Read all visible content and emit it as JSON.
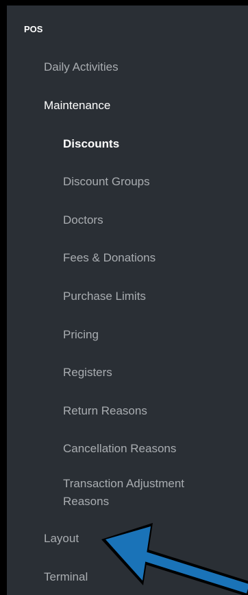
{
  "nav": {
    "root": "POS",
    "daily_activities": "Daily Activities",
    "maintenance": "Maintenance",
    "maintenance_items": [
      "Discounts",
      "Discount Groups",
      "Doctors",
      "Fees & Donations",
      "Purchase Limits",
      "Pricing",
      "Registers",
      "Return Reasons",
      "Cancellation Reasons",
      "Transaction Adjustment Reasons"
    ],
    "layout": "Layout",
    "terminal": "Terminal"
  },
  "colors": {
    "panel_bg": "#2a2f35",
    "text_muted": "#a9adb1",
    "text_active": "#ffffff",
    "annotation_arrow": "#1a73b8"
  },
  "annotation": {
    "icon": "arrow-pointer-icon",
    "target": "Layout"
  }
}
